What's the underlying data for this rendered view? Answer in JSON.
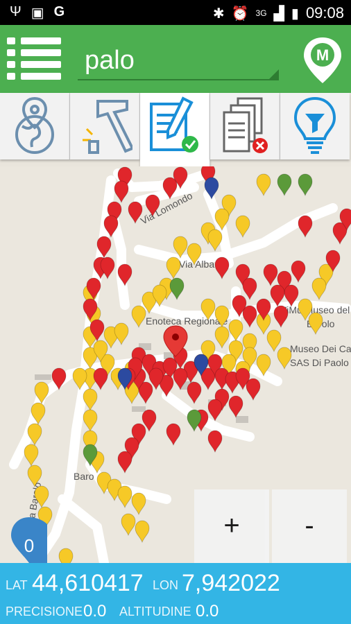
{
  "status_bar": {
    "time": "09:08",
    "network": "3G"
  },
  "search": {
    "value": "palo"
  },
  "map": {
    "street_labels": [
      "Via Lomondo",
      "Via Alba",
      "Enoteca Regionale",
      "Museo Dei Ca",
      "SAS Di Paolo",
      "WiMu Museo del",
      "Barolo",
      "Baro",
      "Via Barolo"
    ],
    "marker_colors": {
      "yellow": "#f6c927",
      "red": "#e0262b",
      "green": "#5b9a3a",
      "blue": "#2c4aa0"
    }
  },
  "zoom": {
    "in_label": "+",
    "out_label": "-"
  },
  "counter": {
    "value": "0"
  },
  "coords": {
    "lat_label": "LAT",
    "lat_value": "44,610417",
    "lon_label": "LON",
    "lon_value": "7,942022",
    "prec_label": "PRECISIONE",
    "prec_value": "0.0",
    "alt_label": "ALTITUDINE",
    "alt_value": "0.0"
  }
}
